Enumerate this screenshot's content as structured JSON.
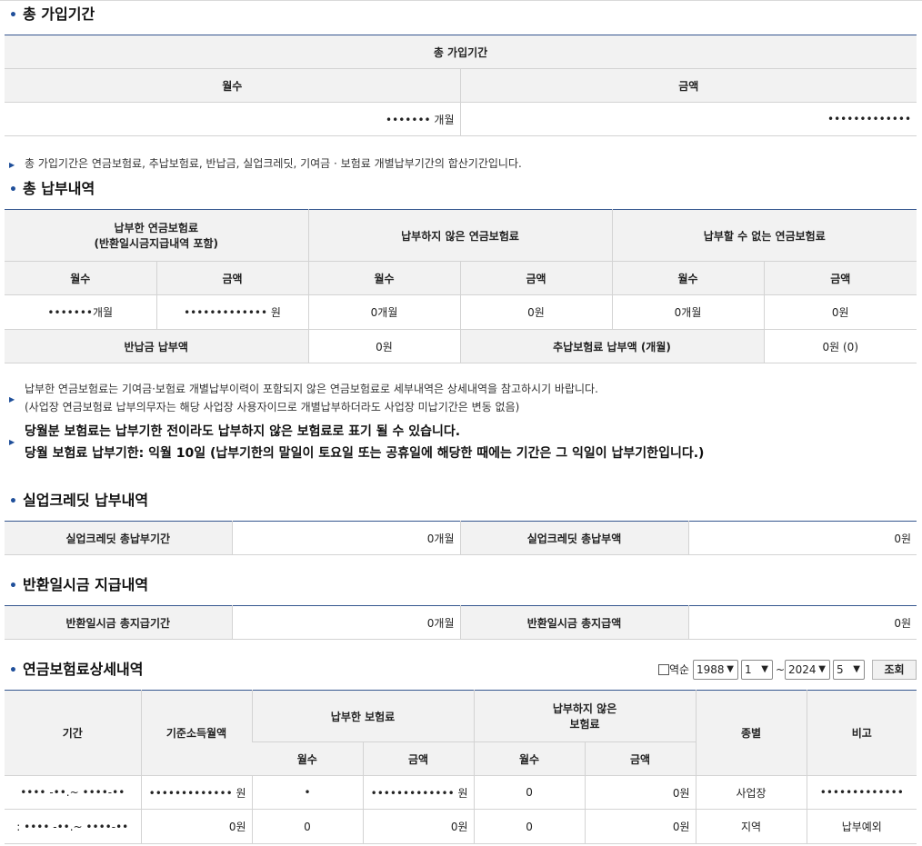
{
  "total_period": {
    "title": "총 가입기간",
    "table_header": "총 가입기간",
    "col_months": "월수",
    "col_amount": "금액",
    "months_value": "••••••• 개월",
    "amount_value": "•••••••••••••",
    "note": "총 가입기간은 연금보험료, 추납보험료, 반납금, 실업크레딧, 기여금 · 보험료 개별납부기간의 합산기간입니다."
  },
  "payment_history": {
    "title": "총 납부내역",
    "group_paid_line1": "납부한 연금보험료",
    "group_paid_line2": "(반환일시금지급내역 포함)",
    "group_unpaid": "납부하지 않은 연금보험료",
    "group_cannot": "납부할 수 없는 연금보험료",
    "sub_months": "월수",
    "sub_amount": "금액",
    "paid_months": "•••••••개월",
    "paid_amount": "••••••••••••• 원",
    "unpaid_months": "0개월",
    "unpaid_amount": "0원",
    "cannot_months": "0개월",
    "cannot_amount": "0원",
    "refund_label": "반납금 납부액",
    "refund_value": "0원",
    "extra_label": "추납보험료 납부액 (개월)",
    "extra_value": "0원 (0)",
    "note_line1": "납부한 연금보험료는 기여금·보험료 개별납부이력이 포함되지 않은 연금보험료로 세부내역은 상세내역을 참고하시기 바랍니다.",
    "note_line2": "(사업장 연금보험료 납부의무자는 해당 사업장 사용자이므로 개별납부하더라도 사업장 미납기간은 변동 없음)",
    "bold_line1": "당월분 보험료는 납부기한 전이라도 납부하지 않은 보험료로 표기 될 수 있습니다.",
    "bold_line2": "당월 보험료 납부기한: 익월 10일 (납부기한의 말일이 토요일 또는 공휴일에 해당한 때에는 기간은 그 익일이 납부기한입니다.)"
  },
  "unemployment": {
    "title": "실업크레딧 납부내역",
    "period_label": "실업크레딧 총납부기간",
    "period_value": "0개월",
    "amount_label": "실업크레딧 총납부액",
    "amount_value": "0원"
  },
  "refund": {
    "title": "반환일시금 지급내역",
    "period_label": "반환일시금 총지급기간",
    "period_value": "0개월",
    "amount_label": "반환일시금 총지급액",
    "amount_value": "0원"
  },
  "detail": {
    "title": "연금보험료상세내역",
    "reverse_label": "역순",
    "from_year": "1988",
    "from_month": "1",
    "tilde": "~",
    "to_year": "2024",
    "to_month": "5",
    "search_button": "조회",
    "col_period": "기간",
    "col_base_income": "기준소득월액",
    "col_paid": "납부한 보험료",
    "col_unpaid_line1": "납부하지 않은",
    "col_unpaid_line2": "보험료",
    "col_type": "종별",
    "col_remark": "비고",
    "sub_months": "월수",
    "sub_amount": "금액",
    "rows": [
      {
        "period": "•••• -••.~ ••••-••",
        "base_income": "••••••••••••• 원",
        "paid_months": "•",
        "paid_amount": "••••••••••••• 원",
        "unpaid_months": "0",
        "unpaid_amount": "0원",
        "type": "사업장",
        "remark": "•••••••••••••"
      },
      {
        "period": ": •••• -••.~ ••••-••",
        "base_income": "0원",
        "paid_months": "0",
        "paid_amount": "0원",
        "unpaid_months": "0",
        "unpaid_amount": "0원",
        "type": "지역",
        "remark": "납부예외"
      }
    ]
  },
  "colors": {
    "accent": "#1f4f9a",
    "header_bg": "#f2f2f2",
    "table_top_border": "#35568f"
  }
}
